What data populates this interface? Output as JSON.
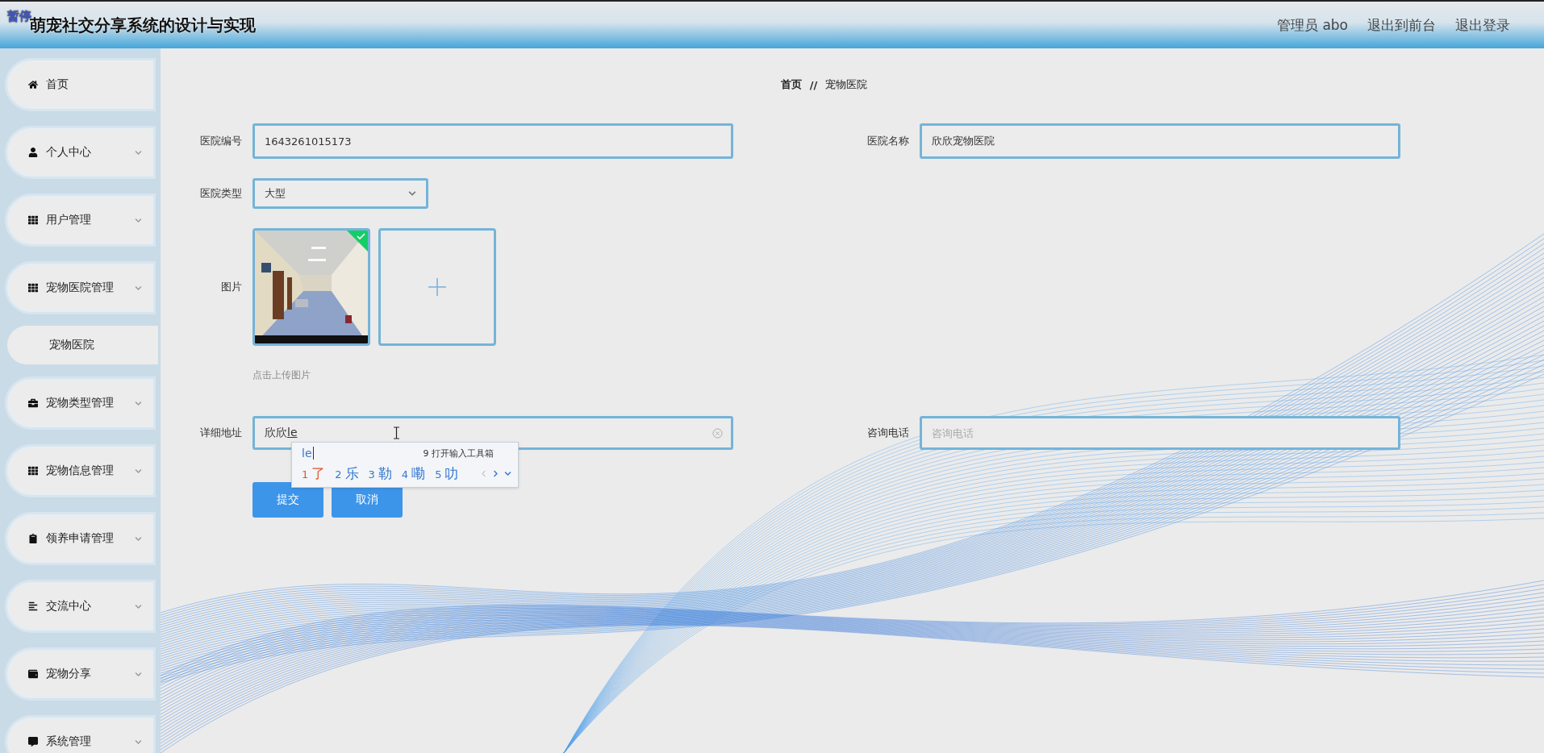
{
  "header": {
    "badge": "暂停",
    "title": "萌宠社交分享系统的设计与实现",
    "links": [
      "管理员 abo",
      "退出到前台",
      "退出登录"
    ]
  },
  "sidebar": {
    "items": [
      {
        "label": "首页",
        "kind": "link"
      },
      {
        "label": "个人中心",
        "kind": "menu"
      },
      {
        "label": "用户管理",
        "kind": "menu"
      },
      {
        "label": "宠物医院管理",
        "kind": "menu",
        "children": [
          {
            "label": "宠物医院"
          }
        ]
      },
      {
        "label": "宠物类型管理",
        "kind": "menu"
      },
      {
        "label": "宠物信息管理",
        "kind": "menu"
      },
      {
        "label": "领养申请管理",
        "kind": "menu"
      },
      {
        "label": "交流中心",
        "kind": "menu"
      },
      {
        "label": "宠物分享",
        "kind": "menu"
      },
      {
        "label": "系统管理",
        "kind": "menu"
      }
    ]
  },
  "breadcrumb": {
    "items": [
      "首页",
      "宠物医院"
    ],
    "separator": "//"
  },
  "form": {
    "hospital_no": {
      "label": "医院编号",
      "value": "1643261015173"
    },
    "hospital_name": {
      "label": "医院名称",
      "value": "欣欣宠物医院"
    },
    "hospital_type": {
      "label": "医院类型",
      "value": "大型"
    },
    "picture": {
      "label": "图片",
      "images": [
        {
          "kind": "picture",
          "uploaded": true
        }
      ],
      "hint": "点击上传图片"
    },
    "address": {
      "label": "详细地址",
      "value": "欣欣",
      "composition": "le"
    },
    "phone": {
      "label": "咨询电话",
      "placeholder": "咨询电话"
    },
    "buttons": [
      "提交",
      "取消"
    ]
  },
  "ime": {
    "composition": "le",
    "tool_hint": "9 打开输入工具箱",
    "candidates": [
      {
        "number": "1",
        "text": "了",
        "selected": true
      },
      {
        "number": "2",
        "text": "乐",
        "selected": false
      },
      {
        "number": "3",
        "text": "勒",
        "selected": false
      },
      {
        "number": "4",
        "text": "嘞",
        "selected": false
      },
      {
        "number": "5",
        "text": "叻",
        "selected": false
      }
    ]
  }
}
